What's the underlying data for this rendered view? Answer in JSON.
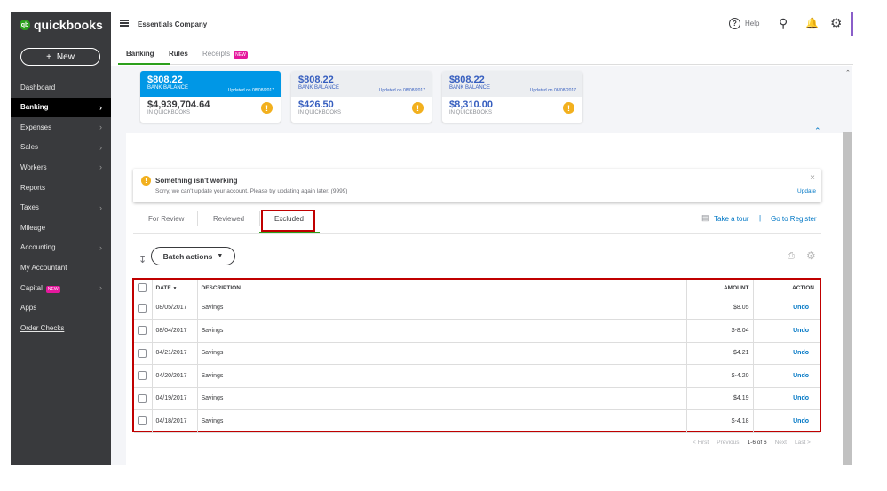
{
  "brand": {
    "logo_text": "quickbooks",
    "new_label": "New"
  },
  "sidebar": {
    "items": [
      {
        "label": "Dashboard",
        "chevron": false
      },
      {
        "label": "Banking",
        "chevron": true,
        "active": true
      },
      {
        "label": "Expenses",
        "chevron": true
      },
      {
        "label": "Sales",
        "chevron": true
      },
      {
        "label": "Workers",
        "chevron": true
      },
      {
        "label": "Reports",
        "chevron": false
      },
      {
        "label": "Taxes",
        "chevron": true
      },
      {
        "label": "Mileage",
        "chevron": false
      },
      {
        "label": "Accounting",
        "chevron": true
      },
      {
        "label": "My Accountant",
        "chevron": false
      },
      {
        "label": "Capital",
        "chevron": true,
        "badge": "NEW"
      },
      {
        "label": "Apps",
        "chevron": false
      },
      {
        "label": "Order Checks",
        "chevron": false
      }
    ]
  },
  "header": {
    "company": "Essentials Company",
    "help": "Help"
  },
  "top_tabs": [
    {
      "label": "Banking"
    },
    {
      "label": "Rules"
    },
    {
      "label": "Receipts",
      "badge": "NEW"
    }
  ],
  "accounts": [
    {
      "bank_balance": "$808.22",
      "bank_label": "BANK BALANCE",
      "updated": "Updated on 08/08/2017",
      "qb_balance": "$4,939,704.64",
      "qb_label": "IN QUICKBOOKS"
    },
    {
      "bank_balance": "$808.22",
      "bank_label": "BANK BALANCE",
      "updated": "Updated on 08/08/2017",
      "qb_balance": "$426.50",
      "qb_label": "IN QUICKBOOKS"
    },
    {
      "bank_balance": "$808.22",
      "bank_label": "BANK BALANCE",
      "updated": "Updated on 08/08/2017",
      "qb_balance": "$8,310.00",
      "qb_label": "IN QUICKBOOKS"
    }
  ],
  "alert": {
    "title": "Something isn't working",
    "message": "Sorry, we can't update your account. Please try updating again later. (9999)",
    "action": "Update"
  },
  "review_tabs": [
    "For Review",
    "Reviewed",
    "Excluded"
  ],
  "links": {
    "tour": "Take a tour",
    "register": "Go to Register"
  },
  "batch_label": "Batch actions",
  "table": {
    "headers": [
      "DATE",
      "DESCRIPTION",
      "AMOUNT",
      "ACTION"
    ],
    "rows": [
      {
        "date": "08/05/2017",
        "desc": "Savings",
        "amount": "$8.05",
        "action": "Undo"
      },
      {
        "date": "08/04/2017",
        "desc": "Savings",
        "amount": "$-8.04",
        "action": "Undo"
      },
      {
        "date": "04/21/2017",
        "desc": "Savings",
        "amount": "$4.21",
        "action": "Undo"
      },
      {
        "date": "04/20/2017",
        "desc": "Savings",
        "amount": "$-4.20",
        "action": "Undo"
      },
      {
        "date": "04/19/2017",
        "desc": "Savings",
        "amount": "$4.19",
        "action": "Undo"
      },
      {
        "date": "04/18/2017",
        "desc": "Savings",
        "amount": "$-4.18",
        "action": "Undo"
      }
    ]
  },
  "pagination": {
    "first": "< First",
    "previous": "Previous",
    "range": "1-6 of 6",
    "next": "Next",
    "last": "Last >"
  }
}
